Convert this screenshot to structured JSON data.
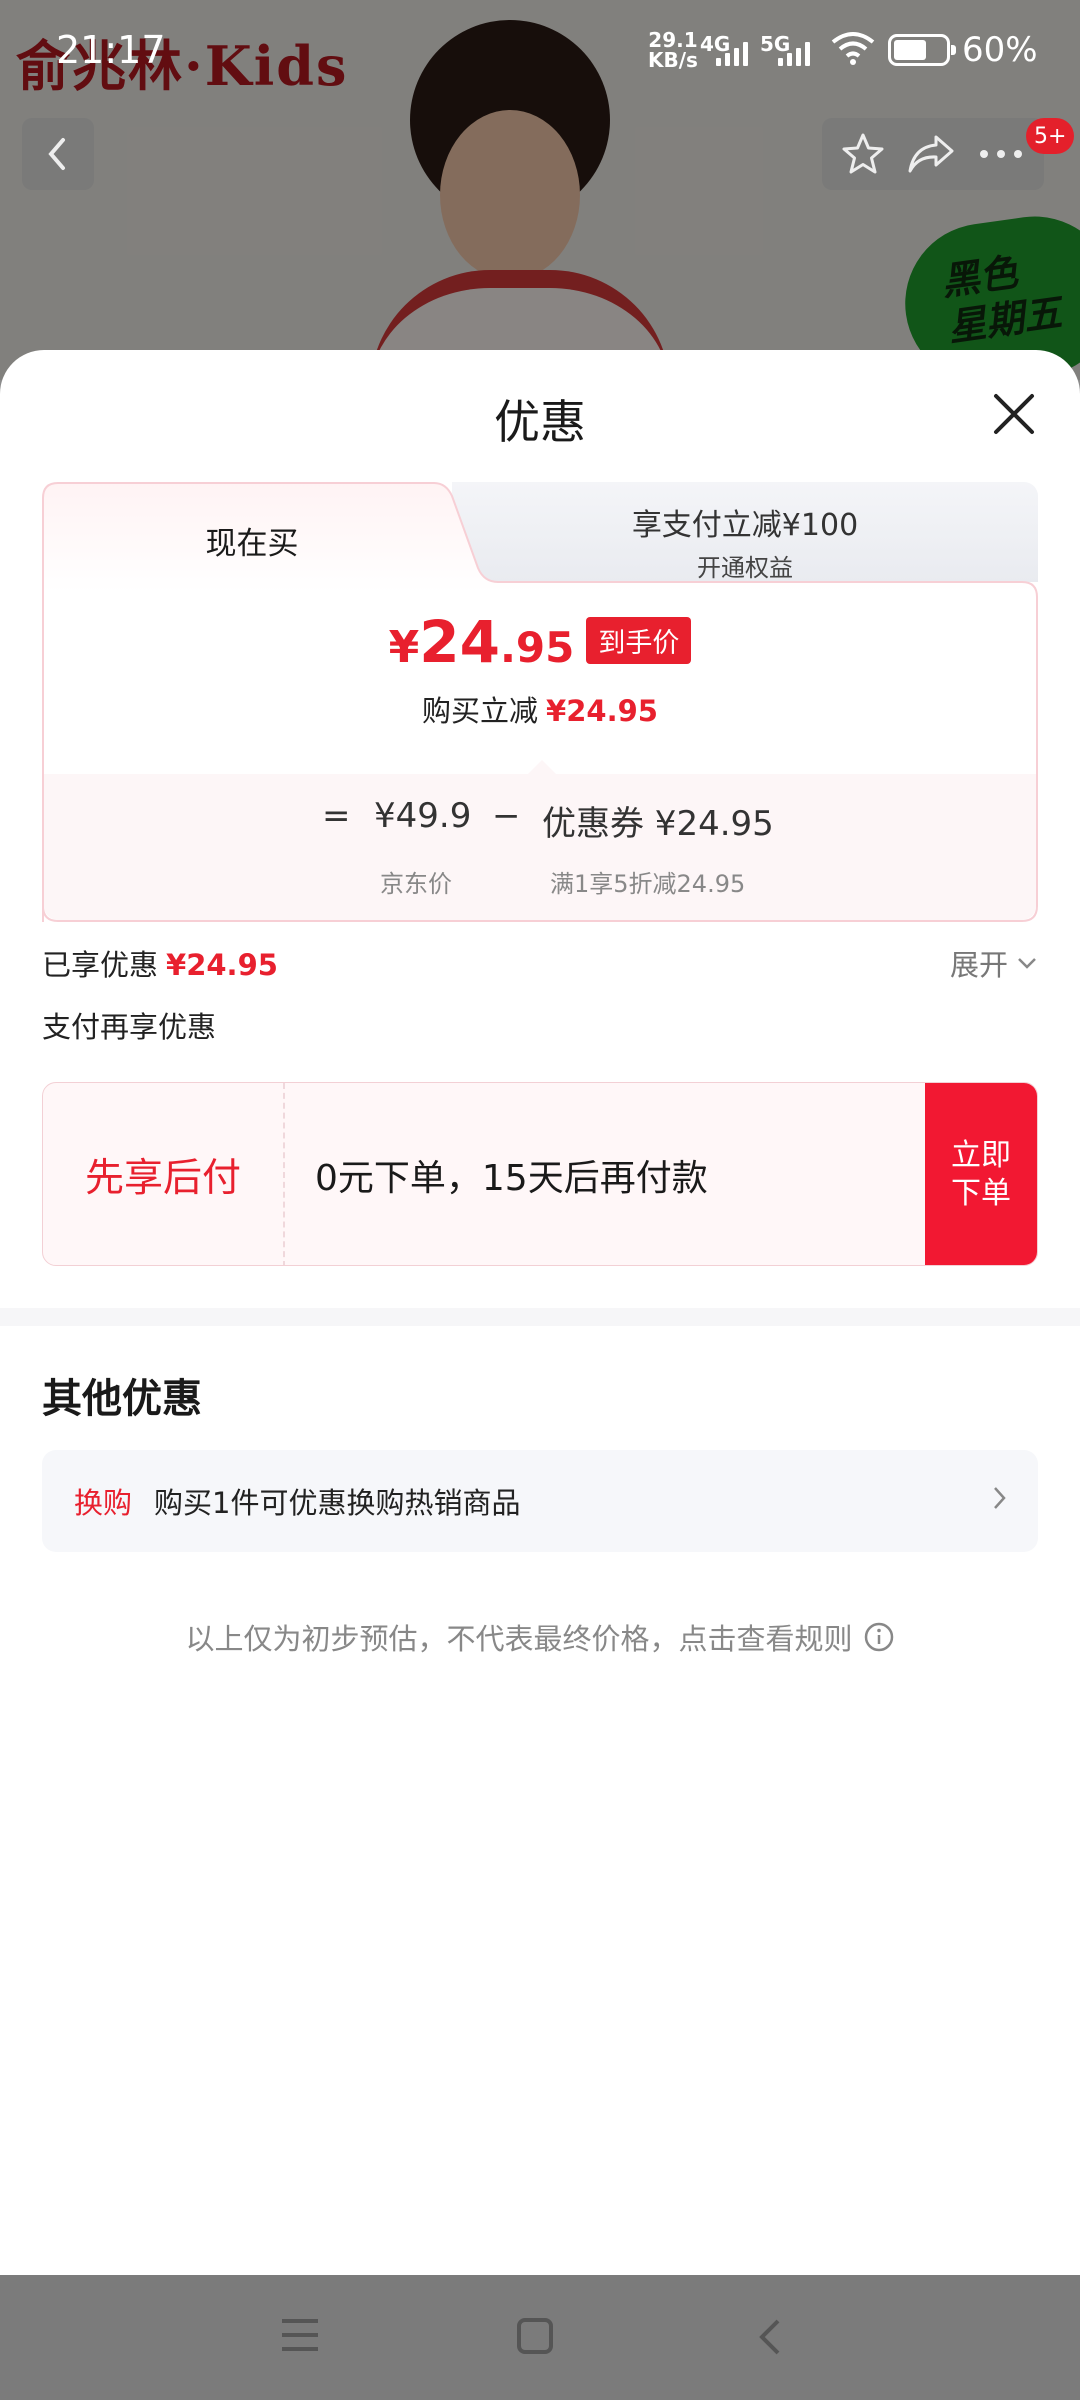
{
  "status_bar": {
    "time": "21:17",
    "net_speed_value": "29.1",
    "net_speed_unit": "KB/s",
    "sig1": "4G",
    "sig2": "5G",
    "battery": "60%"
  },
  "background": {
    "brand": "俞兆林·Kids",
    "promo_badge": "黑色\n星期五",
    "cart_badge": "5+"
  },
  "sheet": {
    "title": "优惠",
    "tabs": {
      "active": "现在买",
      "inactive_line1": "享支付立减¥100",
      "inactive_line2": "开通权益"
    },
    "price": {
      "yen": "¥",
      "integer": "24",
      "decimal": ".95",
      "tag": "到手价"
    },
    "reduce": {
      "label": "购买立减",
      "amount": "¥24.95"
    },
    "calc": {
      "eq": "=",
      "jd_price": "¥49.9",
      "minus": "−",
      "coupon": "优惠券 ¥24.95",
      "jd_price_label": "京东价",
      "coupon_desc": "满1享5折减24.95"
    },
    "summary": {
      "enjoyed_label": "已享优惠",
      "enjoyed_amount": "¥24.95",
      "expand": "展开",
      "pay_again": "支付再享优惠"
    },
    "bnpl": {
      "title": "先享后付",
      "desc": "0元下单，15天后再付款",
      "order_line1": "立即",
      "order_line2": "下单"
    },
    "other": {
      "title": "其他优惠",
      "exchange_tag": "换购",
      "exchange_text": "购买1件可优惠换购热销商品"
    },
    "disclaimer": "以上仅为初步预估，不代表最终价格，点击查看规则"
  },
  "colors": {
    "accent_red": "#e8202e",
    "order_button": "#f21832",
    "nav_bar": "#7b7b7b"
  }
}
